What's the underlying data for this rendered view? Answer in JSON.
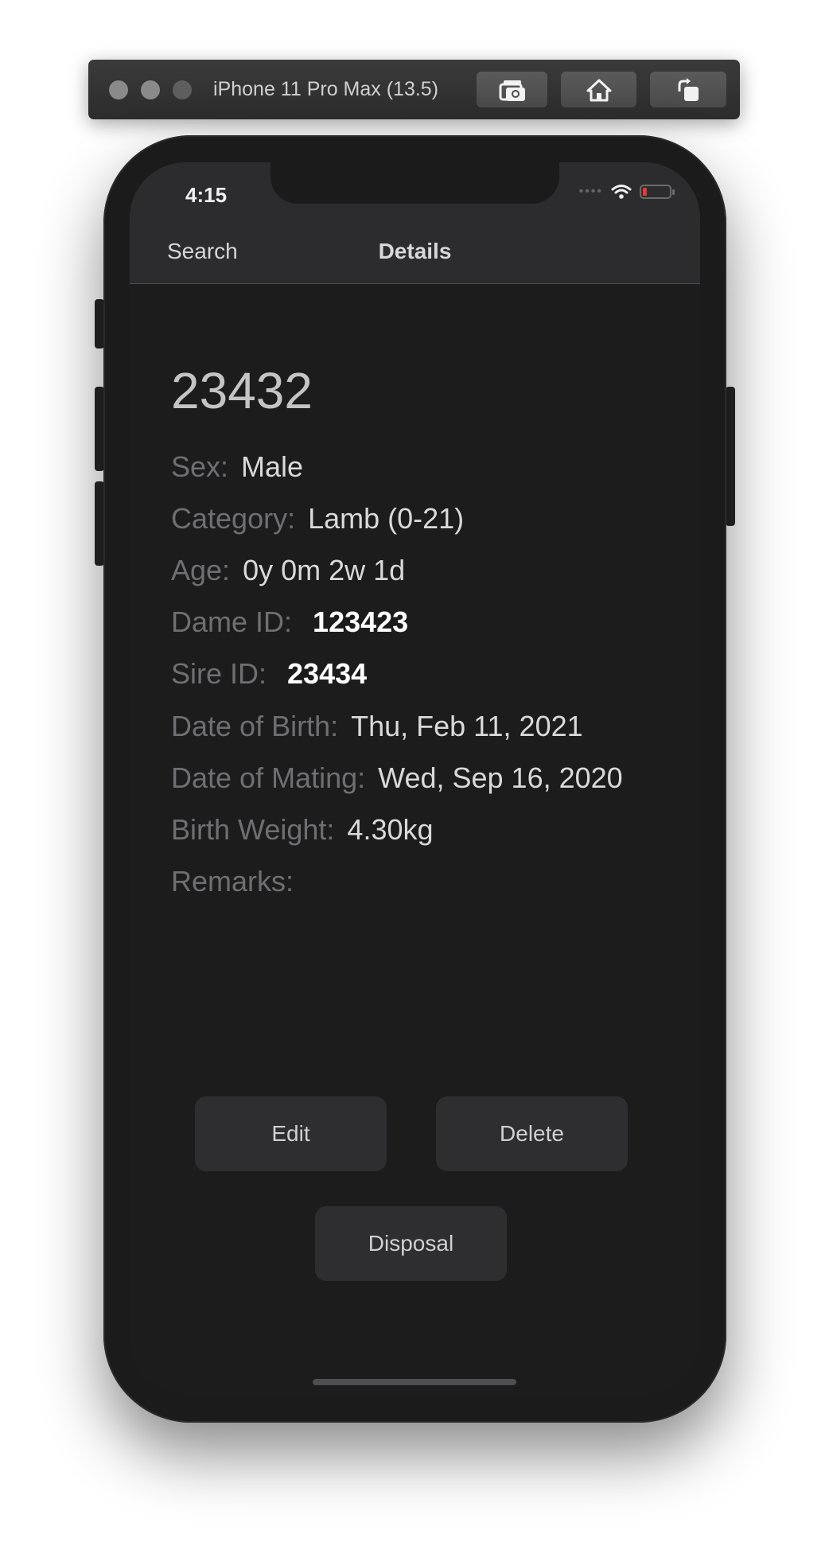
{
  "simulator": {
    "title": "iPhone 11 Pro Max (13.5)",
    "buttons": [
      {
        "icon": "screenshot-icon"
      },
      {
        "icon": "home-icon"
      },
      {
        "icon": "rotate-icon"
      }
    ]
  },
  "status_bar": {
    "time": "4:15",
    "battery_color": "#e53935"
  },
  "nav": {
    "back_label": "Search",
    "title": "Details"
  },
  "record": {
    "id": "23432",
    "fields": [
      {
        "label": "Sex:",
        "value": "Male"
      },
      {
        "label": "Category:",
        "value": "Lamb (0-21)"
      },
      {
        "label": "Age:",
        "value": "0y 0m 2w 1d"
      },
      {
        "label": "Dame ID:",
        "value": "123423"
      },
      {
        "label": "Sire ID:",
        "value": "23434"
      },
      {
        "label": "Date of Birth:",
        "value": "Thu, Feb 11, 2021"
      },
      {
        "label": "Date of Mating:",
        "value": "Wed, Sep 16, 2020"
      },
      {
        "label": "Birth Weight:",
        "value": "4.30kg"
      },
      {
        "label": "Remarks:",
        "value": ""
      }
    ]
  },
  "actions": {
    "edit": "Edit",
    "delete": "Delete",
    "disposal": "Disposal"
  }
}
